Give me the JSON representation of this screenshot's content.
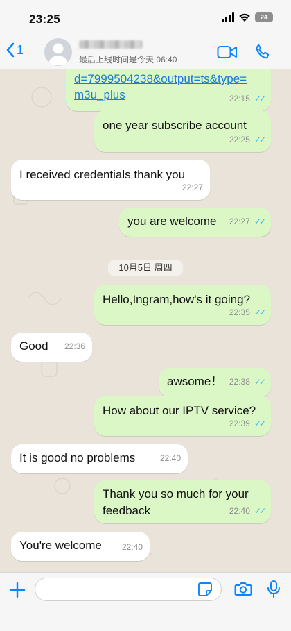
{
  "status_bar": {
    "time": "23:25",
    "battery": "24"
  },
  "header": {
    "back_count": "1",
    "last_seen": "最后上线时间是今天 06:40"
  },
  "messages": [
    {
      "direction": "out",
      "text": "d=7999504238&output=ts&type=\nm3u_plus",
      "time": "22:15",
      "is_link": true
    },
    {
      "direction": "out",
      "text": "one year subscribe account",
      "time": "22:25"
    },
    {
      "direction": "in",
      "text": "I received credentials thank you",
      "time": "22:27"
    },
    {
      "direction": "out",
      "text": "you are welcome",
      "time": "22:27"
    },
    {
      "direction": "out",
      "text": "Hello,Ingram,how's it going?",
      "time": "22:35"
    },
    {
      "direction": "in",
      "text": "Good",
      "time": "22:36"
    },
    {
      "direction": "out",
      "text": "awsome！",
      "time": "22:38"
    },
    {
      "direction": "out",
      "text": "How about our IPTV service?",
      "time": "22:39"
    },
    {
      "direction": "in",
      "text": "It is good no problems",
      "time": "22:40"
    },
    {
      "direction": "out",
      "text": "Thank you so much for your\nfeedback",
      "time": "22:40"
    },
    {
      "direction": "in",
      "text": "You're welcome",
      "time": "22:40"
    }
  ],
  "date_divider": "10月5日 周四",
  "input": {
    "value": "",
    "placeholder": ""
  },
  "colors": {
    "accent": "#0a84ff",
    "outgoing": "#dbf7c5",
    "incoming": "#ffffff",
    "read_ticks": "#34b7f1"
  },
  "icons": {
    "back": "chevron-left-icon",
    "video": "video-camera-icon",
    "phone": "phone-icon",
    "plus": "plus-icon",
    "sticker": "sticker-icon",
    "camera": "camera-icon",
    "mic": "microphone-icon"
  }
}
